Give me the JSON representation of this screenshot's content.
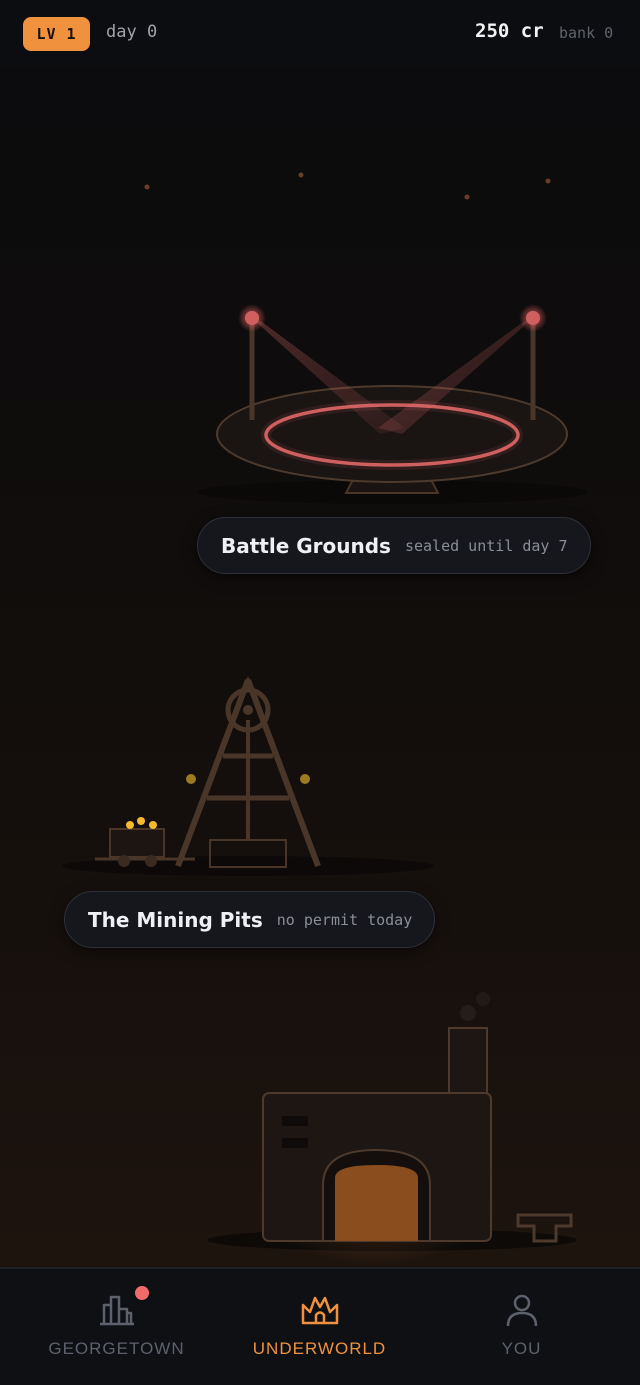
{
  "header": {
    "level_badge": "LV 1",
    "day": "day 0",
    "credits": "250 cr",
    "bank": "bank 0"
  },
  "locations": [
    {
      "title": "Battle Grounds",
      "status": "sealed until day 7"
    },
    {
      "title": "The Mining Pits",
      "status": "no permit today"
    }
  ],
  "nav": {
    "items": [
      {
        "label": "GEORGETOWN",
        "icon": "city-buildings-icon",
        "has_notification": true
      },
      {
        "label": "UNDERWORLD",
        "icon": "crown-flame-icon",
        "active": true
      },
      {
        "label": "YOU",
        "icon": "person-icon"
      }
    ]
  },
  "colors": {
    "accent": "#f0913e",
    "inactive": "#5c616b",
    "notification": "#f26b6b",
    "arena_ring": "#e06868"
  }
}
